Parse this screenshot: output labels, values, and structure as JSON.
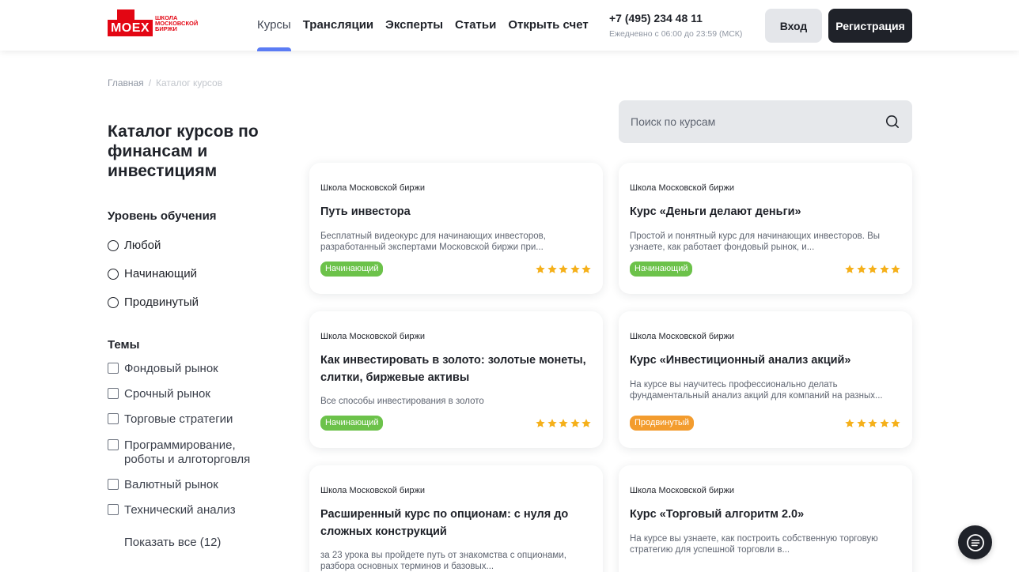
{
  "header": {
    "logo_word": "MOEX",
    "logo_lines": [
      "ШКОЛА",
      "МОСКОВСКОЙ",
      "БИРЖИ"
    ],
    "nav": [
      "Курсы",
      "Трансляции",
      "Эксперты",
      "Статьи",
      "Открыть счет"
    ],
    "phone": "+7 (495) 234 48 11",
    "hours": "Ежедневно с 06:00 до 23:59 (МСК)",
    "login": "Вход",
    "register": "Регистрация"
  },
  "breadcrumb": {
    "home": "Главная",
    "sep": "/",
    "current": "Каталог курсов"
  },
  "sidebar": {
    "title": "Каталог курсов по финансам и инвестициям",
    "level_head": "Уровень обучения",
    "levels": [
      "Любой",
      "Начинающий",
      "Продвинутый"
    ],
    "topics_head": "Темы",
    "topics": [
      "Фондовый рынок",
      "Срочный рынок",
      "Торговые стратегии",
      "Программирование, роботы и алготорговля",
      "Валютный рынок",
      "Технический анализ"
    ],
    "show_all": "Показать все (12)"
  },
  "search": {
    "placeholder": "Поиск по курсам",
    "icon": "search-icon"
  },
  "courses": [
    {
      "org": "Школа Московской биржи",
      "title": "Путь инвестора",
      "desc": "Бесплатный видеокурс для начинающих инвесторов, разработанный экспертами Московской биржи при...",
      "level": "Начинающий",
      "rating": 5
    },
    {
      "org": "Школа Московской биржи",
      "title": "Курс «Деньги делают деньги»",
      "desc": "Простой и понятный курс для начинающих инвесторов. Вы узнаете, как работает фондовый рынок, и...",
      "level": "Начинающий",
      "rating": 5
    },
    {
      "org": "Школа Московской биржи",
      "title": "Как инвестировать в золото: золотые монеты, слитки, биржевые активы",
      "desc": "Все способы инвестирования в золото",
      "level": "Начинающий",
      "rating": 5
    },
    {
      "org": "Школа Московской биржи",
      "title": "Курс «Инвестиционный анализ акций»",
      "desc": "На курсе вы научитесь профессионально делать фундаментальный анализ акций для компаний на разных...",
      "level": "Продвинутый",
      "rating": 5
    },
    {
      "org": "Школа Московской биржи",
      "title": "Расширенный курс по опционам: с нуля до сложных конструкций",
      "desc": "за 23 урока вы пройдете путь от знакомства с опционами, разбора основных терминов и базовых...",
      "level": "",
      "rating": 0
    },
    {
      "org": "Школа Московской биржи",
      "title": "Курс «Торговый алгоритм 2.0»",
      "desc": "На курсе вы узнаете, как построить собственную торговую стратегию для успешной торговли в...",
      "level": "",
      "rating": 0
    }
  ],
  "colors": {
    "brand": "#e30613",
    "dark": "#1f2229",
    "beginner": "#6cc24a",
    "advanced": "#f39c2e",
    "star": "#f5b01a",
    "accent": "#5b7cf4"
  }
}
